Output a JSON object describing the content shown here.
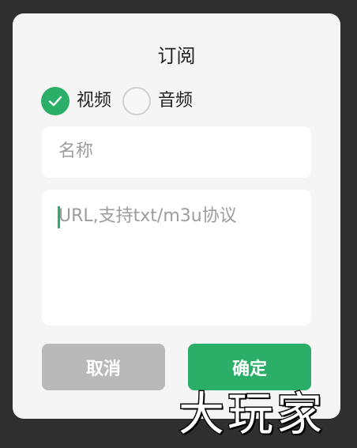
{
  "dialog": {
    "title": "订阅",
    "type_options": [
      {
        "label": "视频",
        "checked": true
      },
      {
        "label": "音频",
        "checked": false
      }
    ],
    "name_field": {
      "value": "",
      "placeholder": "名称"
    },
    "url_field": {
      "value": "",
      "placeholder": "URL,支持txt/m3u协议"
    },
    "cancel_label": "取消",
    "confirm_label": "确定"
  },
  "watermark": "大玩家",
  "icons": {
    "selected": "check-icon"
  },
  "colors": {
    "accent": "#2bae67",
    "cancel": "#b9b9b9",
    "dialog_bg": "#f5f5f5",
    "backdrop": "#2f2f2f"
  }
}
